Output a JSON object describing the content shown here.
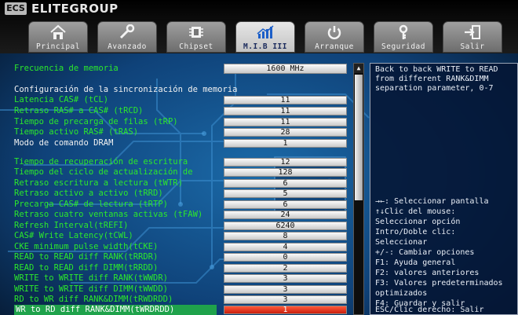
{
  "brand": {
    "logo": "ECS",
    "name": "ELITEGROUP"
  },
  "tabs": [
    {
      "label": "Principal",
      "icon": "home-icon",
      "active": false
    },
    {
      "label": "Avanzado",
      "icon": "wrench-icon",
      "active": false
    },
    {
      "label": "Chipset",
      "icon": "chip-icon",
      "active": false
    },
    {
      "label": "M.I.B III",
      "icon": "chart-icon",
      "active": true
    },
    {
      "label": "Arranque",
      "icon": "power-icon",
      "active": false
    },
    {
      "label": "Seguridad",
      "icon": "key-icon",
      "active": false
    },
    {
      "label": "Salir",
      "icon": "exit-icon",
      "active": false
    }
  ],
  "memory": {
    "freq_label": "Frecuencia de memoria",
    "freq_value": "1600 MHz",
    "section_title": "Configuración de la sincronización de memoria",
    "timings": [
      {
        "label": "Latencia CAS# (tCL)",
        "value": "11"
      },
      {
        "label": "Retraso RAS# a CAS# (tRCD)",
        "value": "11"
      },
      {
        "label": "Tiempo de precarga de filas (tRP)",
        "value": "11"
      },
      {
        "label": "Tiempo activo RAS# (tRAS)",
        "value": "28"
      },
      {
        "label": "Modo de comando DRAM",
        "value": "1"
      }
    ],
    "advanced": [
      {
        "label": "Tiempo de recuperación de escritura",
        "value": "12"
      },
      {
        "label": "Tiempo del ciclo de actualización de",
        "value": "128"
      },
      {
        "label": "Retraso escritura a lectura (tWTR)",
        "value": "6"
      },
      {
        "label": "Retraso activo a activo (tRRD)",
        "value": "5"
      },
      {
        "label": "Precarga CAS# de lectura (tRTP)",
        "value": "6"
      },
      {
        "label": "Retraso cuatro ventanas activas (tFAW)",
        "value": "24"
      },
      {
        "label": "Refresh Interval(tREFI)",
        "value": "6240"
      },
      {
        "label": "CAS# Write Latency(tCWL)",
        "value": "8"
      },
      {
        "label": "CKE minimum pulse width(tCKE)",
        "value": "4"
      },
      {
        "label": "READ to READ diff RANK(tRRDR)",
        "value": "0"
      },
      {
        "label": "READ to READ diff DIMM(tRRDD)",
        "value": "2"
      },
      {
        "label": "WRITE to WRITE diff RANK(tWWDR)",
        "value": "3"
      },
      {
        "label": "WRITE to WRITE diff DIMM(tWWDD)",
        "value": "3"
      },
      {
        "label": "RD to WR diff RANK&DIMM(tRWDRDD)",
        "value": "3"
      },
      {
        "label": "WR to RD diff RANK&DIMM(tWRDRDD)",
        "value": "1",
        "selected": true
      }
    ]
  },
  "help": {
    "description": [
      "Back to back WRITE to READ",
      "from different RANK&DIMM",
      "separation parameter, 0-7"
    ],
    "keys": [
      "→←: Seleccionar pantalla",
      "↑↓Clic del mouse:",
      "Seleccionar opción",
      "Intro/Doble clic:",
      "Seleccionar",
      "+/-: Cambiar opciones",
      "F1: Ayuda general",
      "F2: valores anteriores",
      "F3: Valores predeterminados",
      "optimizados",
      "F4: Guardar y salir",
      "ESC/Clic derecho: Salir"
    ]
  },
  "scroll": {
    "up_arrow": "▲"
  },
  "colors": {
    "accent_green": "#2ce82c",
    "selected_bg": "#1fa24b",
    "selected_value": "#d42a14",
    "help_text": "#e9eef6"
  }
}
